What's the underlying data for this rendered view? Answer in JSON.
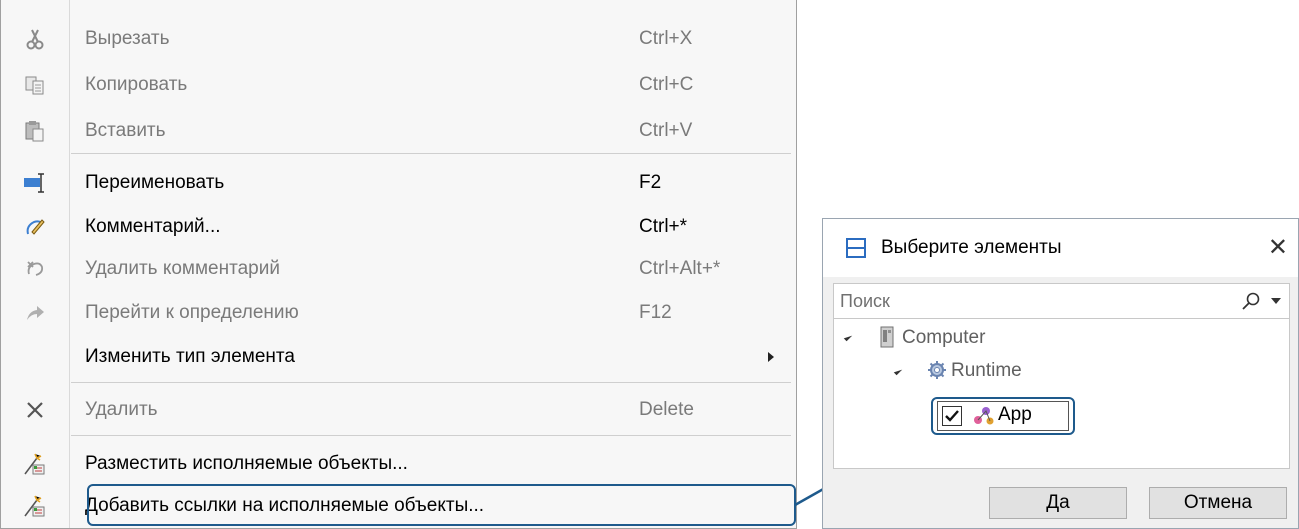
{
  "menu": {
    "items": [
      {
        "label": "Вырезать",
        "shortcut": "Ctrl+X",
        "icon": "scissors-icon",
        "disabled": true
      },
      {
        "label": "Копировать",
        "shortcut": "Ctrl+C",
        "icon": "copy-icon",
        "disabled": true
      },
      {
        "label": "Вставить",
        "shortcut": "Ctrl+V",
        "icon": "paste-icon",
        "disabled": true
      },
      {
        "label": "Переименовать",
        "shortcut": "F2",
        "icon": "rename-icon",
        "disabled": false
      },
      {
        "label": "Комментарий...",
        "shortcut": "Ctrl+*",
        "icon": "comment-icon",
        "disabled": false
      },
      {
        "label": "Удалить комментарий",
        "shortcut": "Ctrl+Alt+*",
        "icon": "remove-comment-icon",
        "disabled": true
      },
      {
        "label": "Перейти к определению",
        "shortcut": "F12",
        "icon": "goto-definition-icon",
        "disabled": true
      },
      {
        "label": "Изменить тип элемента",
        "shortcut": "",
        "icon": "",
        "disabled": false
      },
      {
        "label": "Удалить",
        "shortcut": "Delete",
        "icon": "delete-icon",
        "disabled": true
      },
      {
        "label": "Разместить исполняемые объекты...",
        "shortcut": "",
        "icon": "place-objects-icon",
        "disabled": false
      },
      {
        "label": "Добавить ссылки на исполняемые объекты...",
        "shortcut": "",
        "icon": "add-links-icon",
        "disabled": false
      }
    ]
  },
  "dialog": {
    "title": "Выберите элементы",
    "close": "✕",
    "search_placeholder": "Поиск",
    "tree": {
      "computer": "Computer",
      "runtime": "Runtime",
      "app": "App"
    },
    "ok": "Да",
    "cancel": "Отмена"
  },
  "colors": {
    "highlight": "#1e5a8c",
    "disabled_text": "#7a7a7a"
  }
}
